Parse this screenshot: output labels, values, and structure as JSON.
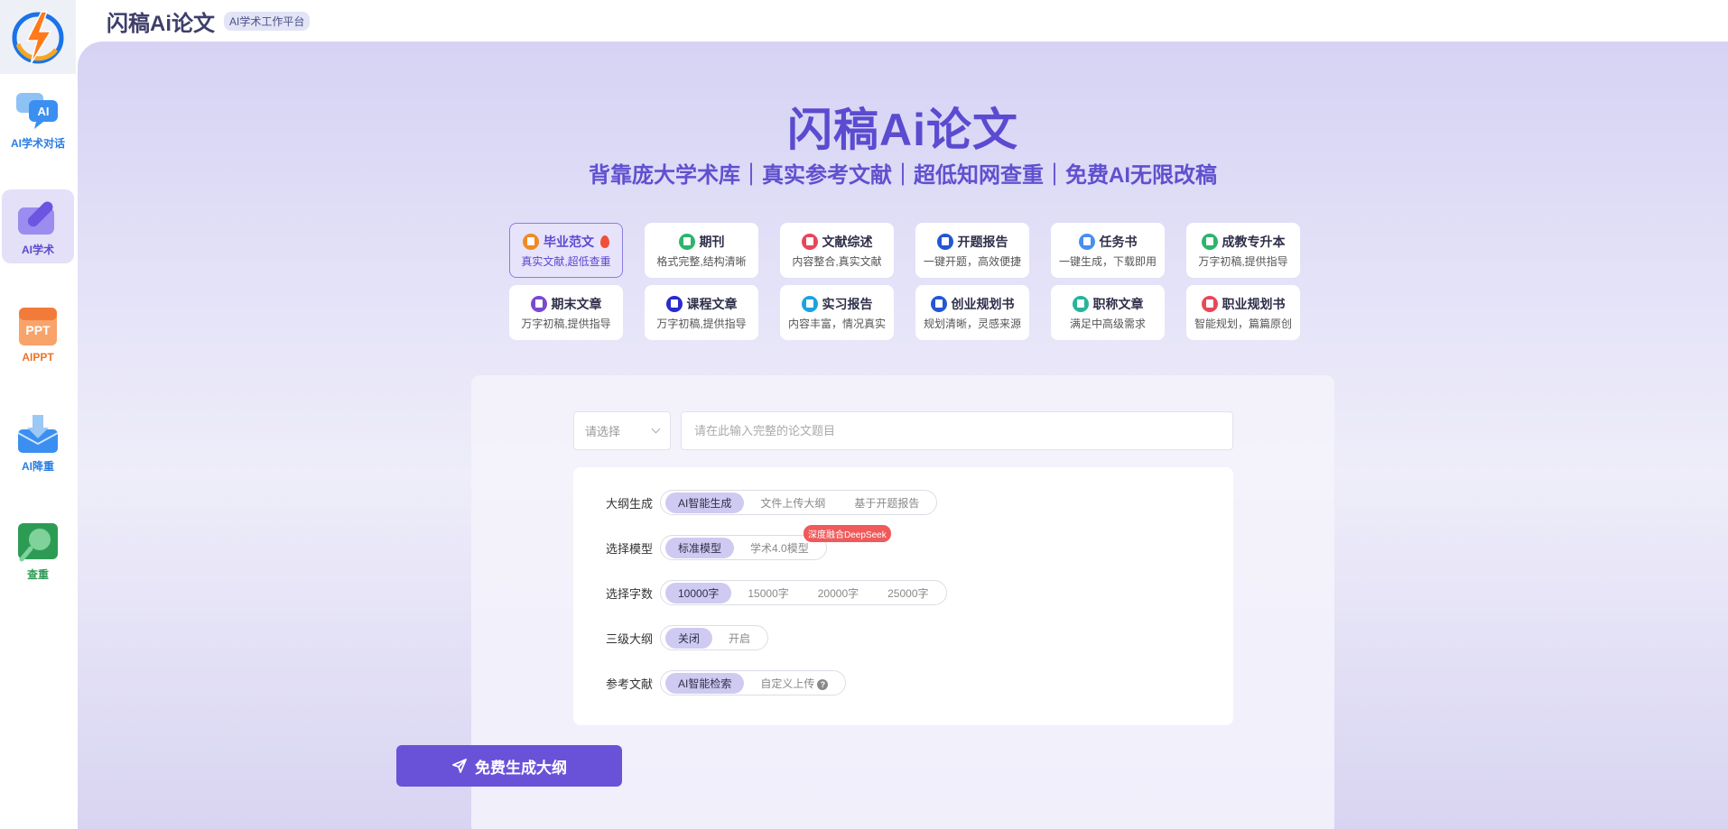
{
  "header": {
    "brand": "闪稿Ai论文",
    "tag": "AI学术工作平台"
  },
  "sidebar": {
    "items": [
      {
        "label": "AI学术对话",
        "icon": "chat-bubble-ai-icon",
        "color": "#2a7de1"
      },
      {
        "label": "AI学术",
        "icon": "pen-icon",
        "color": "#5b4bd0"
      },
      {
        "label": "AIPPT",
        "icon": "ppt-icon",
        "color": "#e8742d"
      },
      {
        "label": "AI降重",
        "icon": "download-tray-icon",
        "color": "#2a7de1"
      },
      {
        "label": "查重",
        "icon": "magnifier-icon",
        "color": "#2e9b55"
      }
    ]
  },
  "hero": {
    "title": "闪稿Ai论文",
    "subtitle": "背靠庞大学术库｜真实参考文献｜超低知网查重｜免费AI无限改稿"
  },
  "cards": [
    {
      "title": "毕业范文",
      "desc": "真实文献,超低查重",
      "color": "#f08a24",
      "hot": true
    },
    {
      "title": "期刊",
      "desc": "格式完整,结构清晰",
      "color": "#2cb56c"
    },
    {
      "title": "文献综述",
      "desc": "内容整合,真实文献",
      "color": "#e8475a"
    },
    {
      "title": "开题报告",
      "desc": "一键开题，高效便捷",
      "color": "#2456d6"
    },
    {
      "title": "任务书",
      "desc": "一键生成，下载即用",
      "color": "#4a8ef0"
    },
    {
      "title": "成教专升本",
      "desc": "万字初稿,提供指导",
      "color": "#2cb56c"
    },
    {
      "title": "期末文章",
      "desc": "万字初稿,提供指导",
      "color": "#7a48d0"
    },
    {
      "title": "课程文章",
      "desc": "万字初稿,提供指导",
      "color": "#2b2ad0"
    },
    {
      "title": "实习报告",
      "desc": "内容丰富，情况真实",
      "color": "#1aa3e0"
    },
    {
      "title": "创业规划书",
      "desc": "规划清晰，灵感来源",
      "color": "#2456d6"
    },
    {
      "title": "职称文章",
      "desc": "满足中高级需求",
      "color": "#26b59a"
    },
    {
      "title": "职业规划书",
      "desc": "智能规划，篇篇原创",
      "color": "#e8475a"
    }
  ],
  "form": {
    "select_placeholder": "请选择",
    "title_placeholder": "请在此输入完整的论文题目",
    "rows": [
      {
        "label": "大纲生成",
        "options": [
          "AI智能生成",
          "文件上传大纲",
          "基于开题报告"
        ],
        "selected": 0
      },
      {
        "label": "选择模型",
        "options": [
          "标准模型",
          "学术4.0模型"
        ],
        "selected": 0,
        "badge": "深度融合DeepSeek"
      },
      {
        "label": "选择字数",
        "options": [
          "10000字",
          "15000字",
          "20000字",
          "25000字"
        ],
        "selected": 0
      },
      {
        "label": "三级大纲",
        "options": [
          "关闭",
          "开启"
        ],
        "selected": 0
      },
      {
        "label": "参考文献",
        "options": [
          "AI智能检索",
          "自定义上传"
        ],
        "selected": 0,
        "help": "?"
      }
    ],
    "submit_label": "免费生成大纲"
  },
  "colors": {
    "accent": "#6a52d8",
    "hero": "#5b4bd0"
  }
}
